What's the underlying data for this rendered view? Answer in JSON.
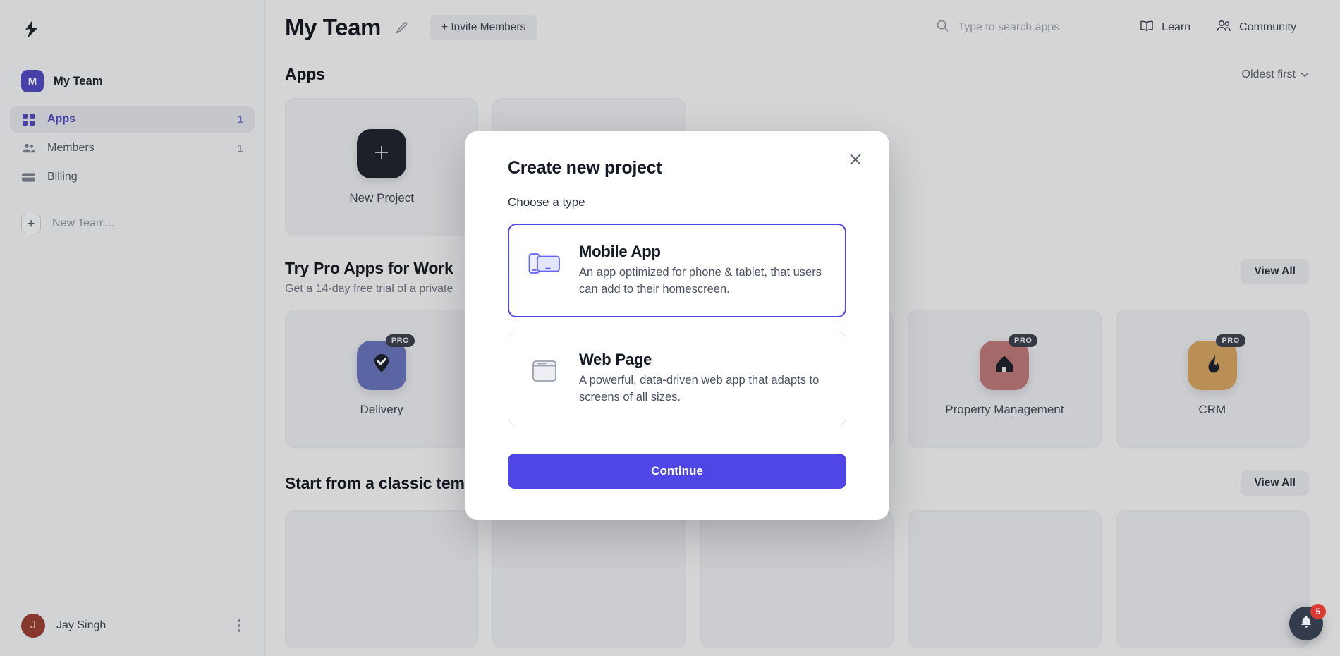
{
  "brand": {
    "logo_icon": "lightning-bolt-logo"
  },
  "sidebar": {
    "team": {
      "avatar_letter": "M",
      "name": "My Team"
    },
    "items": [
      {
        "label": "Apps",
        "count": "1",
        "icon": "grid-icon",
        "active": true
      },
      {
        "label": "Members",
        "count": "1",
        "icon": "people-icon",
        "active": false
      },
      {
        "label": "Billing",
        "count": "",
        "icon": "credit-card-icon",
        "active": false
      }
    ],
    "new_team": {
      "label": "New Team...",
      "icon": "plus-icon"
    },
    "user": {
      "avatar_letter": "J",
      "name": "Jay Singh",
      "menu_icon": "kebab-menu-icon"
    }
  },
  "topbar": {
    "title": "My Team",
    "edit_icon": "pencil-icon",
    "invite_label": "+ Invite Members",
    "search": {
      "placeholder": "Type to search apps",
      "value": "",
      "icon": "search-icon"
    },
    "learn": {
      "label": "Learn",
      "icon": "book-icon"
    },
    "community": {
      "label": "Community",
      "icon": "users-icon"
    }
  },
  "apps_section": {
    "title": "Apps",
    "sort_label": "Oldest first",
    "sort_icon": "chevron-down-icon",
    "cards": [
      {
        "label": "New Project",
        "icon": "plus-icon",
        "tile_color": "#1f2430",
        "pro": false
      }
    ]
  },
  "pro_section": {
    "title": "Try Pro Apps for Work",
    "subtitle": "Get a 14-day free trial of a private",
    "view_all_label": "View All",
    "pro_badge": "PRO",
    "cards": [
      {
        "label": "Delivery",
        "icon": "location-pin-check-icon",
        "tile_color": "#6272d1",
        "pro": true
      },
      {
        "label": "",
        "icon": "",
        "tile_color": "",
        "pro": true
      },
      {
        "label": "",
        "icon": "",
        "tile_color": "",
        "pro": true
      },
      {
        "label": "Property Management",
        "icon": "house-icon",
        "tile_color": "#cf7272",
        "pro": true
      },
      {
        "label": "CRM",
        "icon": "flame-icon",
        "tile_color": "#e0a14a",
        "pro": true
      }
    ]
  },
  "classic_section": {
    "title": "Start from a classic template",
    "view_all_label": "View All",
    "cards": [
      {
        "label": ""
      },
      {
        "label": ""
      },
      {
        "label": ""
      },
      {
        "label": ""
      },
      {
        "label": ""
      }
    ]
  },
  "modal": {
    "title": "Create new project",
    "close_icon": "close-icon",
    "subtitle": "Choose a type",
    "options": [
      {
        "title": "Mobile App",
        "desc": "An app optimized for phone & tablet, that users can add to their homescreen.",
        "icon": "phone-tablet-icon",
        "selected": true
      },
      {
        "title": "Web Page",
        "desc": "A powerful, data-driven web app that adapts to screens of all sizes.",
        "icon": "browser-window-icon",
        "selected": false
      }
    ],
    "continue_label": "Continue"
  },
  "notification": {
    "count": "5",
    "icon": "bell-icon"
  },
  "colors": {
    "accent": "#4f46e5",
    "badge_red": "#dc3b33",
    "sidebar_bg": "#eef0f3",
    "page_bg": "#f2f2f4",
    "card_bg": "#e7e9ee"
  }
}
